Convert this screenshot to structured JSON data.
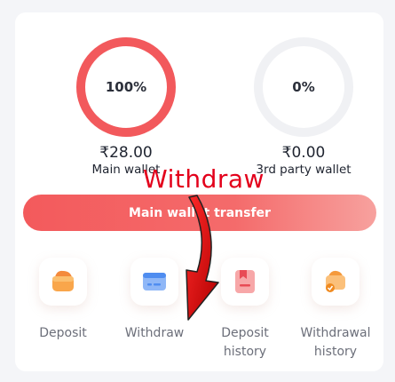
{
  "wallets": {
    "main": {
      "percent": "100%",
      "amount": "₹28.00",
      "label": "Main wallet"
    },
    "third_party": {
      "percent": "0%",
      "amount": "₹0.00",
      "label": "3rd party wallet"
    }
  },
  "transfer_button": {
    "label": "Main wallet transfer"
  },
  "actions": [
    {
      "label": "Deposit",
      "icon": "wallet-icon"
    },
    {
      "label": "Withdraw",
      "icon": "card-icon"
    },
    {
      "label": "Deposit history",
      "icon": "bookmark-document-icon"
    },
    {
      "label": "Withdrawal history",
      "icon": "wallet-check-icon"
    }
  ],
  "annotation": {
    "text": "Withdraw",
    "color": "#e3001b"
  },
  "colors": {
    "accent": "#f2595c",
    "label": "#6c6f7a"
  }
}
